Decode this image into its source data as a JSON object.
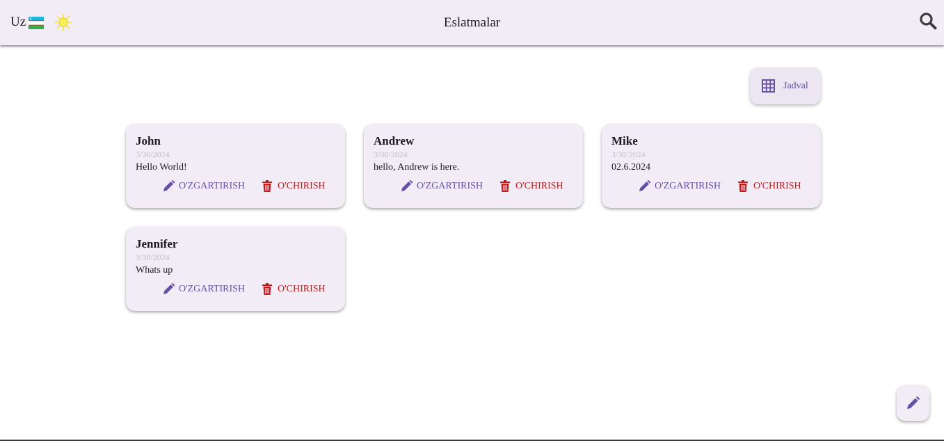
{
  "header": {
    "language": "Uz",
    "title": "Eslatmalar"
  },
  "view_toggle": {
    "label": "Jadval"
  },
  "notes": [
    {
      "name": "John",
      "date": "3/30/2024",
      "text": "Hello World!",
      "edit_label": "O'ZGARTIRISH",
      "delete_label": "O'CHIRISH"
    },
    {
      "name": "Andrew",
      "date": "3/30/2024",
      "text": "hello, Andrew is here.",
      "edit_label": "O'ZGARTIRISH",
      "delete_label": "O'CHIRISH"
    },
    {
      "name": "Mike",
      "date": "3/30/2024",
      "text": "02.6.2024",
      "edit_label": "O'ZGARTIRISH",
      "delete_label": "O'CHIRISH"
    },
    {
      "name": "Jennifer",
      "date": "3/30/2024",
      "text": "Whats up",
      "edit_label": "O'ZGARTIRISH",
      "delete_label": "O'CHIRISH"
    }
  ],
  "icons": {
    "flag": "uzbekistan-flag-icon",
    "theme": "sun-icon",
    "search": "search-icon",
    "grid": "grid-icon",
    "edit": "pencil-icon",
    "delete": "trash-icon",
    "fab": "pencil-icon"
  },
  "colors": {
    "appbar": "#f2ecf7",
    "primary": "#6750a4",
    "danger": "#c51a1a",
    "card": "#f2ecf7"
  }
}
